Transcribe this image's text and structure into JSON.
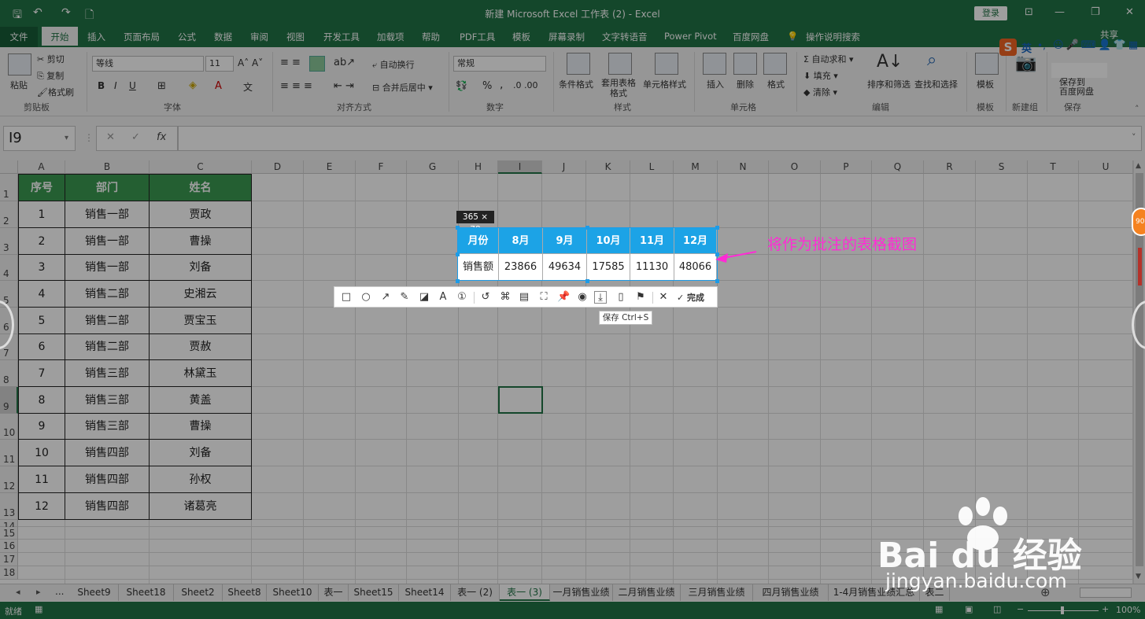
{
  "window": {
    "title": "新建 Microsoft Excel 工作表 (2)  -  Excel",
    "login": "登录",
    "minimize": "—",
    "restore": "❐",
    "close": "✕",
    "ribbon_display": "⊡"
  },
  "quick_access": {
    "save": "🖫",
    "undo": "↶",
    "redo": "↷",
    "preview": "🗋"
  },
  "menu_tabs": {
    "file": "文件",
    "home": "开始",
    "items": [
      "插入",
      "页面布局",
      "公式",
      "数据",
      "审阅",
      "视图",
      "开发工具",
      "加载项",
      "帮助",
      "PDF工具",
      "模板",
      "屏幕录制",
      "文字转语音",
      "Power Pivot",
      "百度网盘"
    ],
    "tell_me": "操作说明搜索",
    "share": "共享"
  },
  "ribbon": {
    "clipboard": {
      "paste": "粘贴",
      "cut": "剪切",
      "copy": "复制",
      "format_painter": "格式刷",
      "group": "剪贴板"
    },
    "font": {
      "name": "等线",
      "size": "11",
      "bold": "B",
      "italic": "I",
      "underline": "U",
      "group": "字体"
    },
    "alignment": {
      "wrap": "自动换行",
      "merge": "合并后居中",
      "group": "对齐方式"
    },
    "number": {
      "format": "常规",
      "percent": "%",
      "comma": ",",
      "group": "数字"
    },
    "styles": {
      "conditional": "条件格式",
      "table": "套用表格格式",
      "cell_styles": "单元格样式",
      "group": "样式"
    },
    "cells": {
      "insert": "插入",
      "delete": "删除",
      "format": "格式",
      "group": "单元格"
    },
    "editing": {
      "autosum": "自动求和",
      "fill": "填充",
      "clear": "清除",
      "sort": "排序和筛选",
      "find": "查找和选择",
      "group": "编辑"
    },
    "template": {
      "label": "模板",
      "group": "模板"
    },
    "newgroup": {
      "label": "新建组"
    },
    "save": {
      "label1": "保存到",
      "label2": "百度网盘",
      "group": "保存"
    }
  },
  "formula_bar": {
    "name_box": "I9",
    "cancel": "✕",
    "enter": "✓",
    "fx": "fx",
    "value": ""
  },
  "columns": [
    "A",
    "B",
    "C",
    "D",
    "E",
    "F",
    "G",
    "H",
    "I",
    "J",
    "K",
    "L",
    "M",
    "N",
    "O",
    "P",
    "Q",
    "R",
    "S",
    "T",
    "U"
  ],
  "rows": [
    "1",
    "2",
    "3",
    "4",
    "5",
    "6",
    "7",
    "8",
    "9",
    "10",
    "11",
    "12",
    "13",
    "14",
    "15",
    "16",
    "17",
    "18"
  ],
  "table": {
    "headers": [
      "序号",
      "部门",
      "姓名"
    ],
    "rows": [
      [
        "1",
        "销售一部",
        "贾政"
      ],
      [
        "2",
        "销售一部",
        "曹操"
      ],
      [
        "3",
        "销售一部",
        "刘备"
      ],
      [
        "4",
        "销售二部",
        "史湘云"
      ],
      [
        "5",
        "销售二部",
        "贾宝玉"
      ],
      [
        "6",
        "销售二部",
        "贾赦"
      ],
      [
        "7",
        "销售三部",
        "林黛玉"
      ],
      [
        "8",
        "销售三部",
        "黄盖"
      ],
      [
        "9",
        "销售三部",
        "曹操"
      ],
      [
        "10",
        "销售四部",
        "刘备"
      ],
      [
        "11",
        "销售四部",
        "孙权"
      ],
      [
        "12",
        "销售四部",
        "诸葛亮"
      ]
    ]
  },
  "screenshot": {
    "size": "365 × 78",
    "headers": [
      "月份",
      "8月",
      "9月",
      "10月",
      "11月",
      "12月"
    ],
    "values": [
      "销售额",
      "23866",
      "49634",
      "17585",
      "11130",
      "48066"
    ]
  },
  "screenshot_toolbar": {
    "icons": [
      "rect-icon",
      "ellipse-icon",
      "arrow-icon",
      "pen-icon",
      "mosaic-icon",
      "text-icon",
      "number-icon",
      "undo-icon",
      "ocr-icon",
      "translate-icon",
      "crop-icon",
      "pin-icon",
      "record-icon",
      "save-icon",
      "long-shot-icon",
      "bookmark-icon",
      "cancel-icon"
    ],
    "done": "完成",
    "tooltip": "保存 Ctrl+S"
  },
  "annotation": "将作为批注的表格截图",
  "sheet_tabs": [
    "Sheet9",
    "Sheet18",
    "Sheet2",
    "Sheet8",
    "Sheet10",
    "表一",
    "Sheet15",
    "Sheet14",
    "表一 (2)",
    "表一 (3)",
    "一月销售业绩",
    "二月销售业绩",
    "三月销售业绩",
    "四月销售业绩",
    "1-4月销售业绩汇总",
    "表二"
  ],
  "active_sheet": "表一 (3)",
  "sheet_nav": {
    "prev": "◂",
    "next": "▸",
    "more": "...",
    "add": "⊕"
  },
  "status": {
    "mode": "就绪",
    "zoom": "100%",
    "minus": "−",
    "plus": "+"
  },
  "ime": {
    "logo": "S",
    "lang": "英",
    "punct": "•,"
  },
  "side_badge": "90",
  "watermark": {
    "brand": "Bai du 经验",
    "url": "jingyan.baidu.com"
  },
  "colors": {
    "excel_green": "#217346",
    "header_green": "#3a9a52",
    "shot_blue": "#1ca3e6",
    "annotation": "#ff2bd5"
  }
}
